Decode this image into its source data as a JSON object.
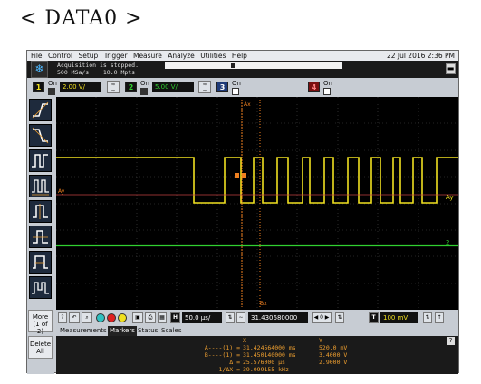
{
  "page_heading": "< DATA0 >",
  "menu": {
    "items": [
      "File",
      "Control",
      "Setup",
      "Trigger",
      "Measure",
      "Analyze",
      "Utilities",
      "Help"
    ],
    "datetime": "22 Jul 2016  2:36 PM"
  },
  "acquisition": {
    "status": "Acquisition is stopped.",
    "rate": "500 MSa/s    10.0 Mpts"
  },
  "channels": [
    {
      "number": "1",
      "on_label": "On",
      "scale": "2.00 V/",
      "color": "#f0e020"
    },
    {
      "number": "2",
      "on_label": "On",
      "scale": "5.00 V/",
      "color": "#30d030"
    },
    {
      "number": "3",
      "on_label": "On",
      "scale": "",
      "color": "#3a6fd8"
    },
    {
      "number": "4",
      "on_label": "On",
      "scale": "",
      "color": "#e03030"
    }
  ],
  "sidebar": {
    "more_label": "More",
    "more_sub": "(1 of 2)",
    "delete_label": "Delete",
    "delete_sub": "All"
  },
  "grid_labels": {
    "top_marker": "Ax",
    "bottom_marker": "Bx",
    "left_marker": "Ay",
    "ch1_marker": "Ay",
    "ch2_marker": "2"
  },
  "bottom_bar": {
    "timebase": "50.0 µs/",
    "delay": "31.430680000 ms",
    "trigger_level": "100 mV"
  },
  "tabs": [
    "Measurements",
    "Markers",
    "Status",
    "Scales"
  ],
  "active_tab": "Markers",
  "markers": {
    "col_x": "X",
    "col_y": "Y",
    "rows": [
      {
        "label": "A----(1) =",
        "x": "31.424564000 ms",
        "y": "520.0 mV"
      },
      {
        "label": "B----(1) =",
        "x": "31.450140000 ms",
        "y": "3.4000 V"
      },
      {
        "label": "Δ =",
        "x": "25.576000 µs",
        "y": "2.9000 V"
      },
      {
        "label": "1/ΔX =",
        "x": "39.099155 kHz",
        "y": ""
      }
    ],
    "help_label": "?"
  },
  "colors": {
    "ch1_trace": "#f0e020",
    "ch2_trace": "#30d030",
    "marker": "#f08020",
    "grid_bg": "#000000"
  }
}
